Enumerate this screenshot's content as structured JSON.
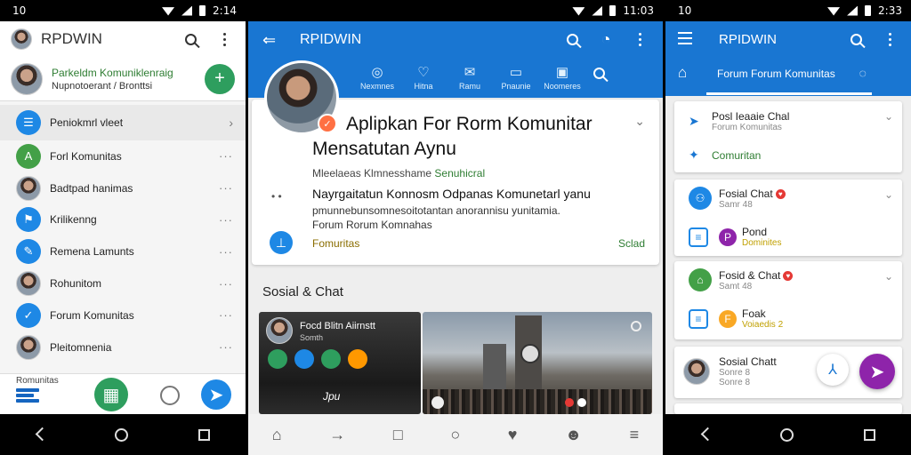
{
  "panel1": {
    "status": {
      "time": "10",
      "clock": "2:14"
    },
    "app_title": "RPDWIN",
    "profile": {
      "line1": "Parkeldm Komuniklenraig",
      "line2": "Nupnotoerant / Bronttsi"
    },
    "menu": [
      {
        "label": "Peniokmrl vleet",
        "icon": "chat-icon",
        "color": "#1e88e5",
        "trail": "chevron"
      },
      {
        "label": "Forl Komunitas",
        "icon": "app-icon",
        "color": "#43a047",
        "trail": "more"
      },
      {
        "label": "Badtpad hanimas",
        "icon": "person-icon",
        "color": "#6d4c41",
        "trail": "more"
      },
      {
        "label": "Krilikenng",
        "icon": "flag-icon",
        "color": "#1e88e5",
        "trail": "more"
      },
      {
        "label": "Remena Lamunts",
        "icon": "pen-icon",
        "color": "#1e88e5",
        "trail": "more"
      },
      {
        "label": "Rohunitom",
        "icon": "person-icon",
        "color": "#5d4037",
        "trail": "more"
      },
      {
        "label": "Forum Komunitas",
        "icon": "compass-icon",
        "color": "#1e88e5",
        "trail": "more"
      },
      {
        "label": "Pleitomnenia",
        "icon": "person-icon",
        "color": "#6d4c41",
        "trail": "more"
      }
    ],
    "bottom_peek": "Romunitas",
    "colors": {
      "accent_green": "#2e9e5e",
      "accent_blue": "#1976d2"
    }
  },
  "panel2": {
    "status": {
      "clock": "11:03"
    },
    "app_title": "RPIDWIN",
    "tabs": [
      "Nexmnes",
      "Hitna",
      "Ramu",
      "Pnaunie",
      "Noomeres"
    ],
    "card": {
      "title_1": "Aplipkan For Rorm Komunitar",
      "title_2": "Mensatutan Aynu",
      "subtitle": "Mleelaeas Klmnesshame",
      "subtitle_green": "Senuhicral",
      "desc_1": "Nayrgaitatun Konnosm Odpanas Komunetarl yanu",
      "desc_2": "pmunnebunsomnesoitotantan anorannisu yunitamia.",
      "desc_3": "Forum Rorum Komnahas",
      "footer_left": "Fomuritas",
      "footer_right": "Sclad"
    },
    "section_title": "Sosial & Chat",
    "tile_a": {
      "title": "Focd Blitn Aiirnstt",
      "subtitle": "Somth",
      "caption": "Jpu"
    },
    "bottom_nav": [
      "home-icon",
      "arrow-icon",
      "square-icon",
      "circle-icon",
      "heart-icon",
      "person-icon",
      "menu-icon"
    ]
  },
  "panel3": {
    "status": {
      "time": "10",
      "clock": "2:33"
    },
    "app_title": "RPIDWIN",
    "tab_label": "Forum Forum Komunitas",
    "cards": [
      {
        "title": "Posl Ieaaie Chal",
        "meta": "Forum Komunitas",
        "link": "Comuritan"
      },
      {
        "title": "Fosial Chat",
        "meta": "Samr 48",
        "row2_title": "Pond",
        "row2_meta": "Dominites"
      },
      {
        "title": "Fosid & Chat",
        "meta": "Samt 48",
        "row2_title": "Foak",
        "row2_meta": "Voiaedis 2"
      },
      {
        "title": "Sosial Chatt",
        "meta": "Sonre 8",
        "meta2": "Sonre 8"
      }
    ]
  }
}
